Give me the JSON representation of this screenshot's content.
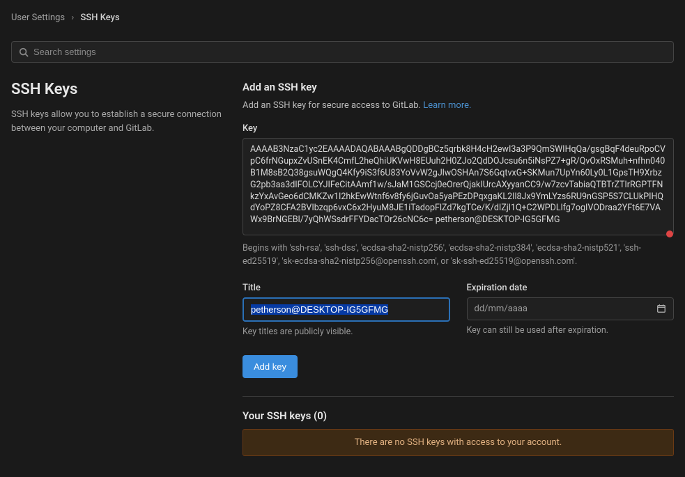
{
  "breadcrumb": {
    "parent": "User Settings",
    "current": "SSH Keys"
  },
  "search": {
    "placeholder": "Search settings"
  },
  "sidebar": {
    "title": "SSH Keys",
    "description": "SSH keys allow you to establish a secure connection between your computer and GitLab."
  },
  "form": {
    "heading": "Add an SSH key",
    "intro_text": "Add an SSH key for secure access to GitLab. ",
    "learn_more": "Learn more.",
    "key_label": "Key",
    "key_value": "AAAAB3NzaC1yc2EAAAADAQABAAABgQDDgBCz5qrbk8H4cH2ewI3a3P9QmSWIHqQa/gsgBqF4deuRpoCVpC6frNGupxZvUSnEK4CmfL2heQhiUKVwH8EUuh2H0ZJo2QdDOJcsu6n5iNsPZ7+gR/QvOxRSMuh+nfhn040B1M8sB2Q38gsuWQgQ4Kfy9iS3f6U83YoVvW2gJlwOSHAn7S6GqtvxG+SKMun7UpYn60Ly0L1GpsTH9XrbzG2pb3aa3dIFOLCYJIFeCitAAmf1w/sJaM1GSCcj0eOrerQjakIUrcAXyyanCC9/w7zcvTabiaQTBTrZTIrRGPTFNkzYxAvGeo6dCMKZw1I2hkEwWtnf6v8fy6jGuvOa5yaPEzDPqxgaKL2Il8Jx9YmLYzs6RU9nGSP5S7CLUkPIHQdYoPZ8CFA2BVIbzqp6vxC6x2HyuM8JE1iTadopFlZd7kgTCe/K/dIZjl1Q+C2WPDLlfg7ogIVODraa2YFt6E7VAWx9BrNGEBl/7yQhWSsdrFFYDacTOr26cNC6c= petherson@DESKTOP-IG5GFMG",
    "key_helper": "Begins with 'ssh-rsa', 'ssh-dss', 'ecdsa-sha2-nistp256', 'ecdsa-sha2-nistp384', 'ecdsa-sha2-nistp521', 'ssh-ed25519', 'sk-ecdsa-sha2-nistp256@openssh.com', or 'sk-ssh-ed25519@openssh.com'.",
    "title_label": "Title",
    "title_value": "petherson@DESKTOP-IG5GFMG",
    "title_helper": "Key titles are publicly visible.",
    "expiration_label": "Expiration date",
    "expiration_placeholder": "dd/mm/aaaa",
    "expiration_helper": "Key can still be used after expiration.",
    "submit_label": "Add key"
  },
  "keys_list": {
    "heading": "Your SSH keys (0)",
    "empty_message": "There are no SSH keys with access to your account."
  }
}
